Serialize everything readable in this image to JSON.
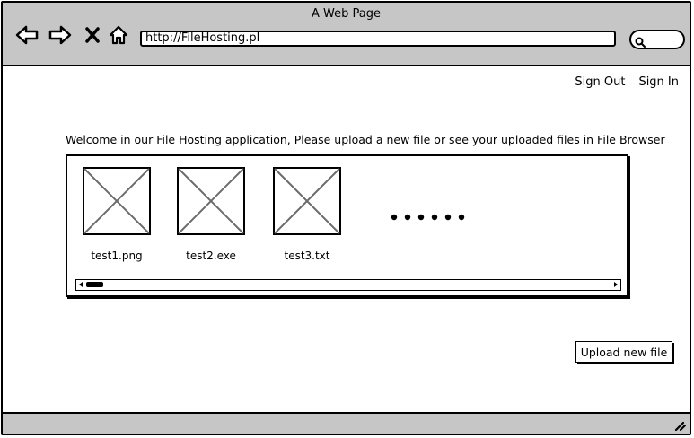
{
  "window": {
    "title": "A Web Page"
  },
  "toolbar": {
    "back_icon": "arrow-left-icon",
    "forward_icon": "arrow-right-icon",
    "stop_icon": "close-icon",
    "home_icon": "home-icon",
    "url": "http://FileHosting.pl",
    "search_icon": "search-icon"
  },
  "header": {
    "sign_out": "Sign Out",
    "sign_in": "Sign In"
  },
  "main": {
    "welcome_text": "Welcome in our File Hosting application, Please upload a new file or see your uploaded files in File Browser",
    "files": [
      {
        "name": "test1.png",
        "icon": "image-placeholder-icon"
      },
      {
        "name": "test2.exe",
        "icon": "image-placeholder-icon"
      },
      {
        "name": "test3.txt",
        "icon": "image-placeholder-icon"
      }
    ],
    "more_indicator": "more-items-icon",
    "upload_button": "Upload new file"
  },
  "colors": {
    "chrome_gray": "#c6c6c6",
    "stroke": "#000000",
    "background": "#ffffff"
  }
}
